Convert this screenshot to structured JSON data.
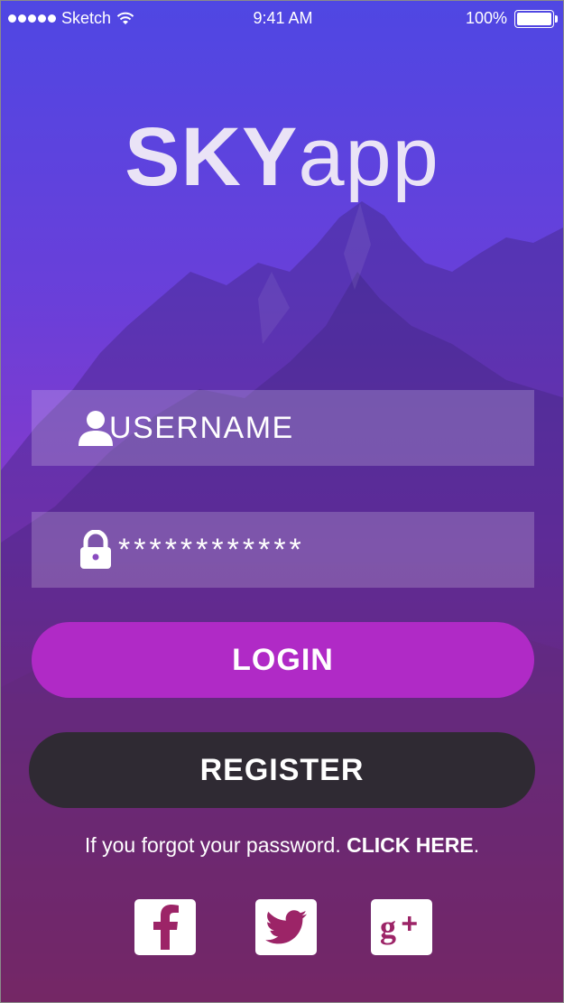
{
  "status_bar": {
    "carrier": "Sketch",
    "time": "9:41 AM",
    "battery": "100%",
    "battery_level": 1.0
  },
  "logo": {
    "bold": "SKY",
    "light": "app"
  },
  "login_form": {
    "username_placeholder": "USERNAME",
    "password_value": "************",
    "login_label": "LOGIN",
    "register_label": "REGISTER",
    "forgot_text": "If you forgot your password. ",
    "forgot_link": "CLICK HERE",
    "forgot_end": "."
  },
  "social": {
    "facebook_icon": "facebook-icon",
    "twitter_icon": "twitter-icon",
    "google_icon": "google-plus-icon",
    "icon_color": "#9c2467"
  },
  "colors": {
    "gradient_top": "#4f47e3",
    "gradient_bottom": "#c23068",
    "login_button": "#b02ac6",
    "register_button": "#2f2a33"
  }
}
